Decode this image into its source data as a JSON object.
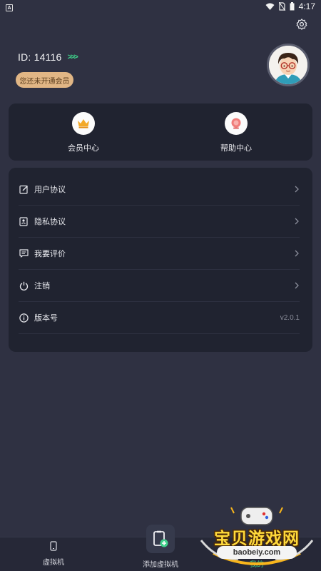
{
  "status_bar": {
    "left_icon": "A",
    "time": "4:17"
  },
  "profile": {
    "id_text": "ID: 14116",
    "chevrons": ">>>",
    "vip_badge": "您还未开通会员"
  },
  "quick_actions": [
    {
      "label": "会员中心",
      "icon": "crown-icon"
    },
    {
      "label": "帮助中心",
      "icon": "help-icon"
    }
  ],
  "menu": [
    {
      "label": "用户协议",
      "icon": "edit-doc-icon"
    },
    {
      "label": "隐私协议",
      "icon": "privacy-doc-icon"
    },
    {
      "label": "我要评价",
      "icon": "comment-icon"
    },
    {
      "label": "注销",
      "icon": "power-icon"
    },
    {
      "label": "版本号",
      "icon": "info-icon",
      "value": "v2.0.1"
    }
  ],
  "bottom_nav": {
    "left_label": "虚拟机",
    "center_label": "添加虚拟机",
    "right_label": "我的"
  },
  "watermark": {
    "title": "宝贝游戏网",
    "url": "baobeiy.com"
  },
  "colors": {
    "background": "#2f3142",
    "card": "#202330",
    "accent": "#3fd08a",
    "badge": "#e1b685"
  }
}
